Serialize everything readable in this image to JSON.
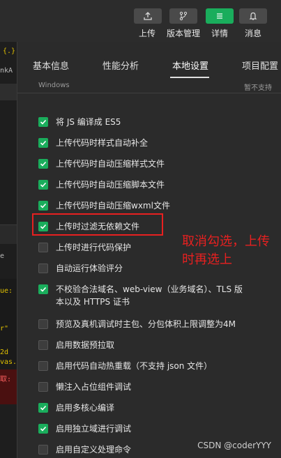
{
  "toolbar": {
    "buttons": [
      {
        "label": "上传",
        "icon": "upload-icon"
      },
      {
        "label": "版本管理",
        "icon": "branch-icon"
      },
      {
        "label": "详情",
        "icon": "menu-icon",
        "active": true
      },
      {
        "label": "消息",
        "icon": "bell-icon"
      }
    ],
    "active_color": "#1aad5c"
  },
  "left_strip": {
    "rows": [
      "{.}",
      "nkA",
      "ue:",
      "r\"",
      "2d",
      "vas.",
      "取:",
      "e"
    ]
  },
  "tabs": [
    {
      "label": "基本信息"
    },
    {
      "label": "性能分析"
    },
    {
      "label": "本地设置",
      "active": true
    },
    {
      "label": "项目配置"
    }
  ],
  "subheader": {
    "left": "Windows",
    "right": "暂不支持"
  },
  "options": [
    {
      "label": "将 JS 编译成 ES5",
      "checked": true
    },
    {
      "label": "上传代码时样式自动补全",
      "checked": true
    },
    {
      "label": "上传代码时自动压缩样式文件",
      "checked": true
    },
    {
      "label": "上传代码时自动压缩脚本文件",
      "checked": true
    },
    {
      "label": "上传代码时自动压缩wxml文件",
      "checked": true
    },
    {
      "label": "上传时过滤无依赖文件",
      "checked": true
    },
    {
      "label": "上传时进行代码保护",
      "checked": false
    },
    {
      "label": "自动运行体验评分",
      "checked": false
    },
    {
      "label": "不校验合法域名、web-view（业务域名）、TLS 版本以及 HTTPS 证书",
      "checked": true
    },
    {
      "label": "预览及真机调试时主包、分包体积上限调整为4M",
      "checked": false
    },
    {
      "label": "启用数据预拉取",
      "checked": false
    },
    {
      "label": "启用代码自动热重载（不支持 json 文件）",
      "checked": false
    },
    {
      "label": "懒注入占位组件调试",
      "checked": false
    },
    {
      "label": "启用多核心编译",
      "checked": true
    },
    {
      "label": "启用独立域进行调试",
      "checked": true
    },
    {
      "label": "启用自定义处理命令",
      "checked": false
    }
  ],
  "annotation": {
    "text": "取消勾选，上传时再选上",
    "color": "#e82020"
  },
  "watermark": "CSDN @coderYYY"
}
